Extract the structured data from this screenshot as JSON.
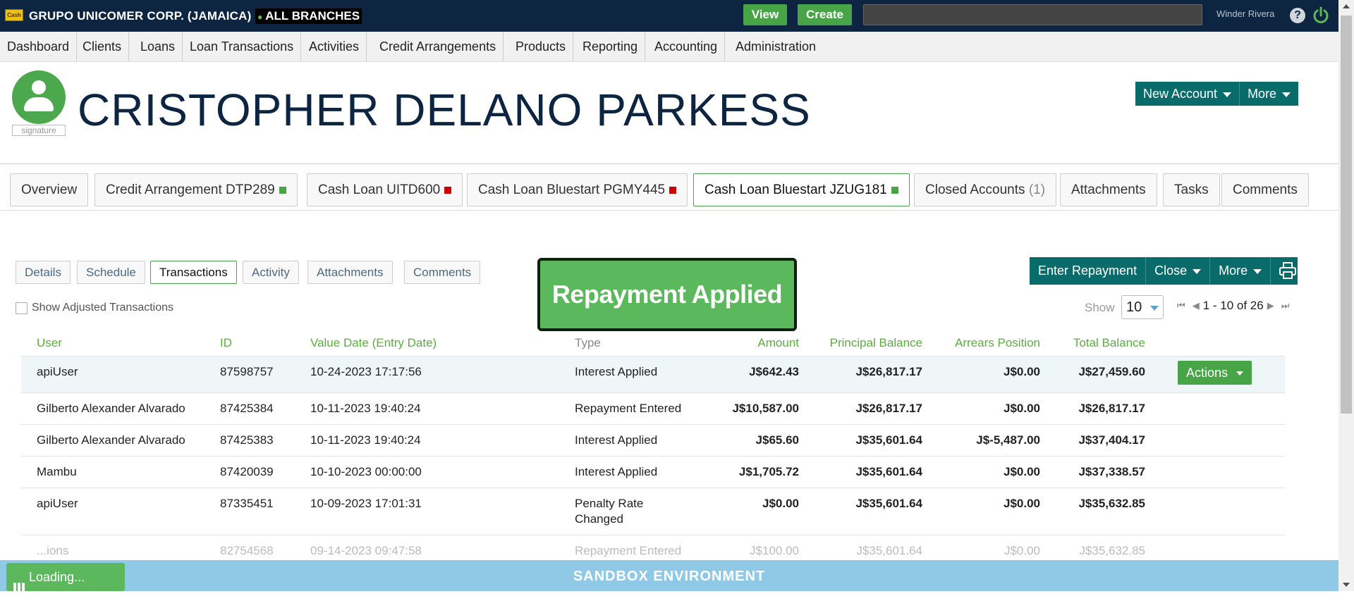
{
  "topbar": {
    "logo_text": "Cash",
    "org_name": "GRUPO UNICOMER CORP. (JAMAICA)",
    "branch": "ALL BRANCHES",
    "view_label": "View",
    "create_label": "Create",
    "search_value": "",
    "user_name": "Winder Rivera",
    "help_glyph": "?"
  },
  "nav": {
    "items": [
      "Dashboard",
      "Clients",
      "Loans",
      "Loan Transactions",
      "Activities",
      "Credit Arrangements",
      "Products",
      "Reporting",
      "Accounting",
      "Administration"
    ]
  },
  "client": {
    "signature_label": "signature",
    "name": "CRISTOPHER DELANO PARKESS",
    "new_account_label": "New Account",
    "more_label": "More"
  },
  "account_tabs": [
    {
      "label": "Overview"
    },
    {
      "label": "Credit Arrangement DTP289",
      "status_color": "#47a447"
    },
    {
      "label": "Cash Loan UITD600",
      "status_color": "#cc0000"
    },
    {
      "label": "Cash Loan Bluestart PGMY445",
      "status_color": "#cc0000"
    },
    {
      "label": "Cash Loan Bluestart JZUG181",
      "status_color": "#47a447",
      "active": true
    },
    {
      "label": "Closed Accounts",
      "count": "(1)"
    },
    {
      "label": "Attachments"
    },
    {
      "label": "Tasks"
    },
    {
      "label": "Comments"
    }
  ],
  "sub_tabs": [
    "Details",
    "Schedule",
    "Transactions",
    "Activity",
    "Attachments",
    "Comments"
  ],
  "active_sub_tab": "Transactions",
  "toast": "Repayment Applied",
  "actions_bar": {
    "enter_repayment": "Enter Repayment",
    "close": "Close",
    "more": "More"
  },
  "filters": {
    "show_adjusted_label": "Show Adjusted Transactions",
    "show_adjusted_checked": false,
    "show_label": "Show",
    "page_size": "10",
    "pager_text": "1 - 10 of 26"
  },
  "table": {
    "headers": {
      "user": "User",
      "id": "ID",
      "value_date": "Value Date (Entry Date)",
      "type": "Type",
      "amount": "Amount",
      "principal_balance": "Principal Balance",
      "arrears_position": "Arrears Position",
      "total_balance": "Total Balance"
    },
    "actions_label": "Actions",
    "rows": [
      {
        "user": "apiUser",
        "id": "87598757",
        "date": "10-24-2023 17:17:56",
        "type": "Interest Applied",
        "amount": "J$642.43",
        "principal": "J$26,817.17",
        "arrears": "J$0.00",
        "total": "J$27,459.60"
      },
      {
        "user": "Gilberto Alexander Alvarado",
        "id": "87425384",
        "date": "10-11-2023 19:40:24",
        "type": "Repayment Entered",
        "amount": "J$10,587.00",
        "principal": "J$26,817.17",
        "arrears": "J$0.00",
        "total": "J$26,817.17"
      },
      {
        "user": "Gilberto Alexander Alvarado",
        "id": "87425383",
        "date": "10-11-2023 19:40:24",
        "type": "Interest Applied",
        "amount": "J$65.60",
        "principal": "J$35,601.64",
        "arrears": "J$-5,487.00",
        "total": "J$37,404.17"
      },
      {
        "user": "Mambu",
        "id": "87420039",
        "date": "10-10-2023 00:00:00",
        "type": "Interest Applied",
        "amount": "J$1,705.72",
        "principal": "J$35,601.64",
        "arrears": "J$0.00",
        "total": "J$37,338.57"
      },
      {
        "user": "apiUser",
        "id": "87335451",
        "date": "10-09-2023 17:01:31",
        "type": "Penalty Rate Changed",
        "amount": "J$0.00",
        "principal": "J$35,601.64",
        "arrears": "J$0.00",
        "total": "J$35,632.85"
      },
      {
        "user": "...ions",
        "id": "82754568",
        "date": "09-14-2023 09:47:58",
        "type": "Repayment Entered",
        "amount": "J$100.00",
        "principal": "J$35,601.64",
        "arrears": "J$0.00",
        "total": "J$35,632.85"
      }
    ]
  },
  "footer": {
    "sandbox": "SANDBOX ENVIRONMENT",
    "loading": "Loading..."
  }
}
